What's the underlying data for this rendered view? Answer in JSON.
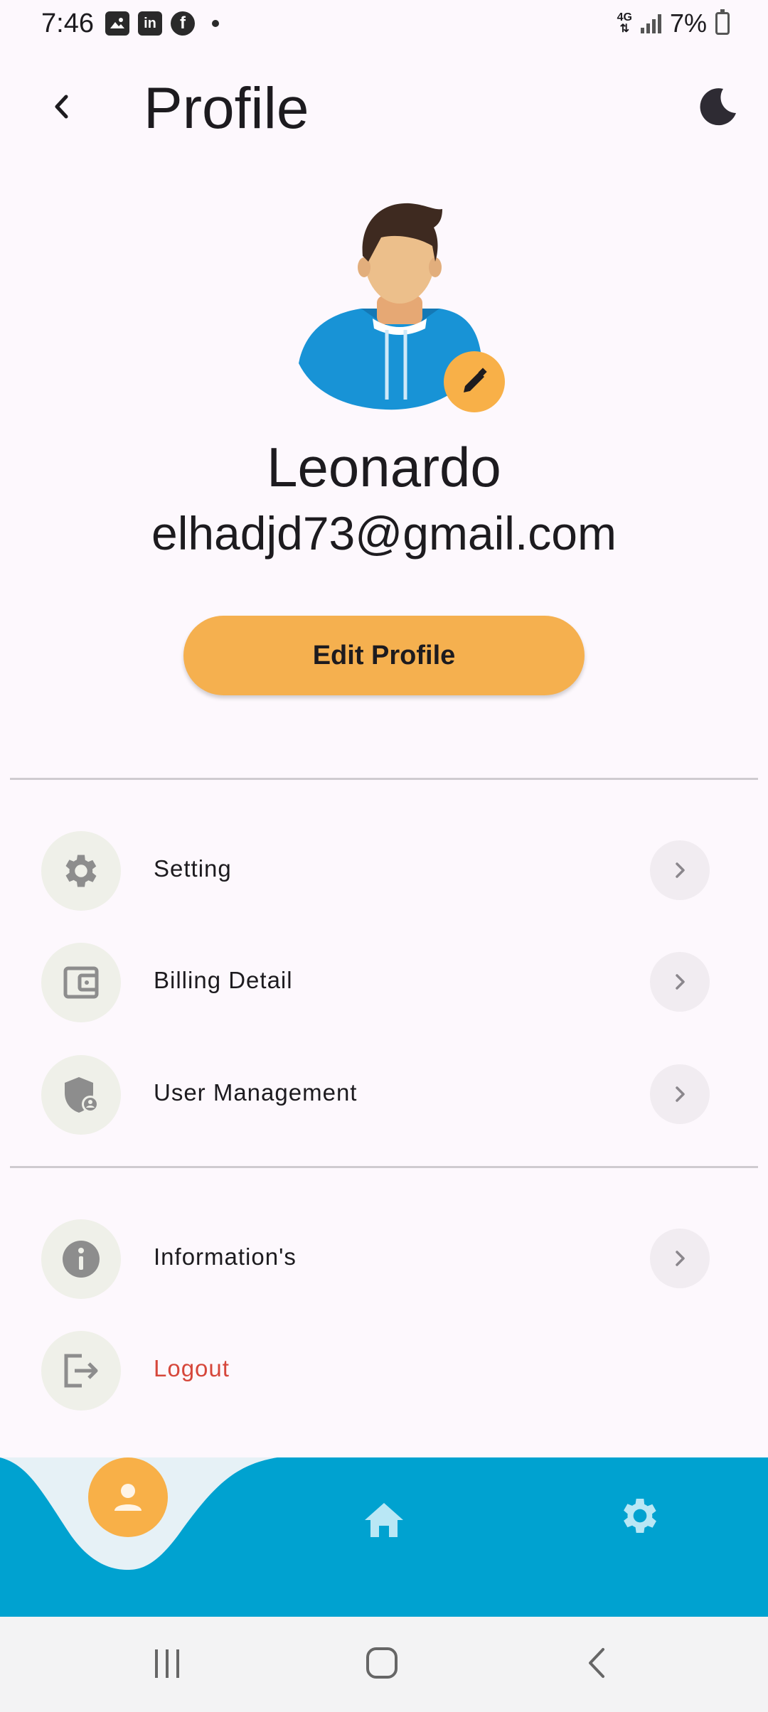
{
  "status": {
    "time": "7:46",
    "network": "4G",
    "battery": "7%",
    "app_icons": [
      "image-icon",
      "linkedin-icon",
      "facebook-icon"
    ],
    "linkedin_glyph": "in",
    "facebook_glyph": "f"
  },
  "header": {
    "title": "Profile",
    "back_icon": "chevron-left-icon",
    "theme_icon": "moon-icon"
  },
  "profile": {
    "name": "Leonardo",
    "email": "elhadjd73@gmail.com",
    "edit_button": "Edit Profile"
  },
  "menu": {
    "items": [
      {
        "label": "Setting",
        "icon": "gear-icon",
        "has_chevron": true
      },
      {
        "label": "Billing Detail",
        "icon": "wallet-icon",
        "has_chevron": true
      },
      {
        "label": "User Management",
        "icon": "shield-user-icon",
        "has_chevron": true
      }
    ],
    "secondary": [
      {
        "label": "Information's",
        "icon": "info-icon",
        "has_chevron": true
      },
      {
        "label": "Logout",
        "icon": "logout-icon",
        "has_chevron": false
      }
    ]
  },
  "bottom_nav": {
    "items": [
      "person-icon",
      "home-icon",
      "gear-icon"
    ],
    "active": "person-icon"
  },
  "colors": {
    "accent": "#F8B048",
    "nav_blue": "#00A2D0",
    "logout_red": "#D6473B",
    "background": "#FDF8FD"
  }
}
